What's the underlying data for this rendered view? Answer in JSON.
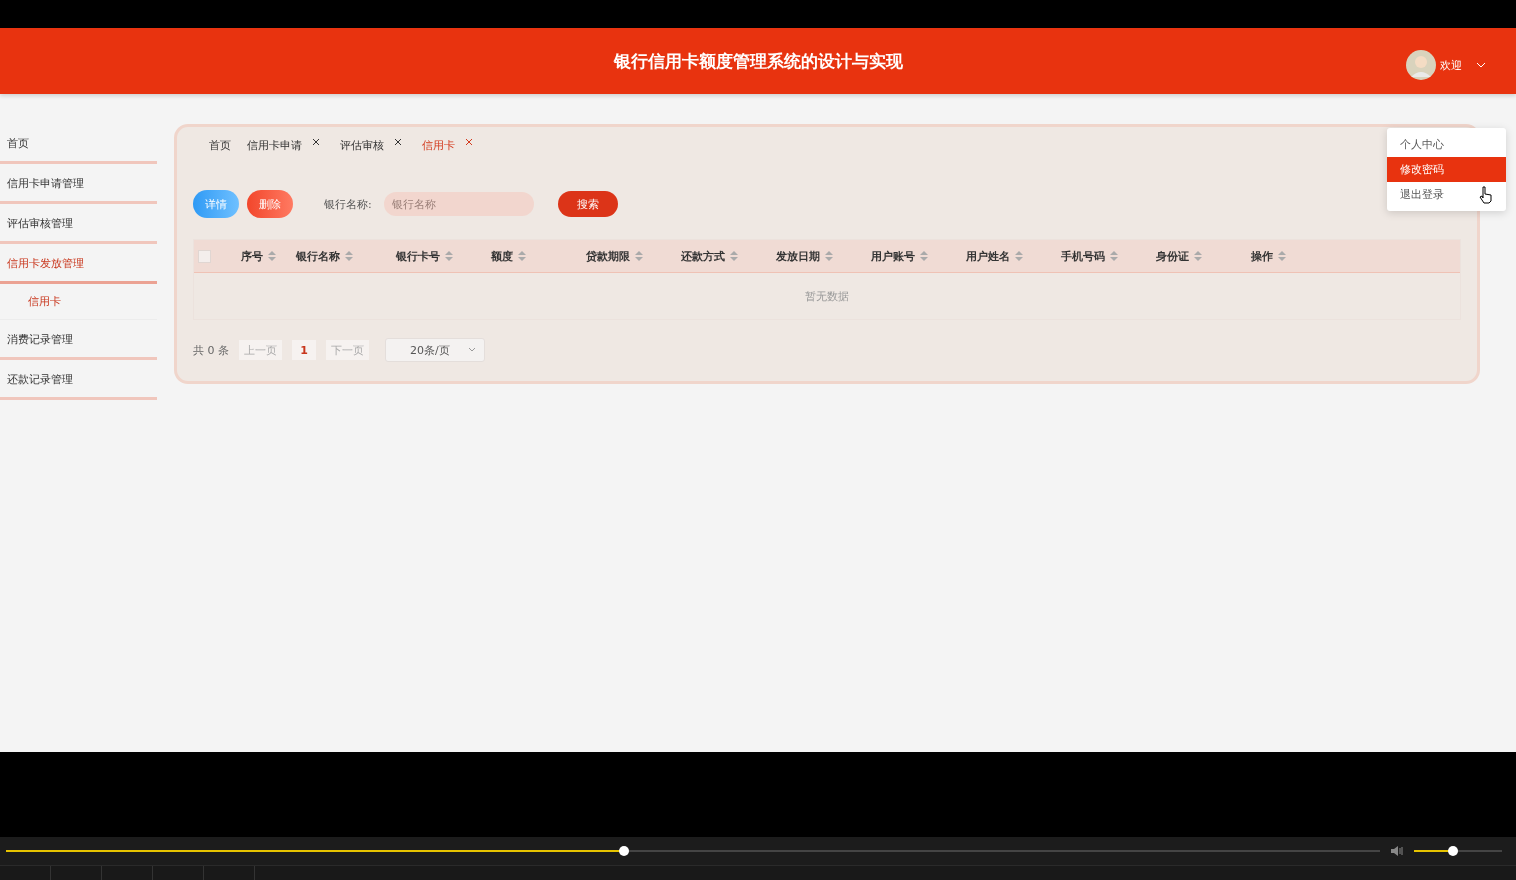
{
  "header": {
    "title": "银行信用卡额度管理系统的设计与实现",
    "greeting": "欢迎"
  },
  "user_menu": [
    {
      "label": "个人中心",
      "selected": false
    },
    {
      "label": "修改密码",
      "selected": true
    },
    {
      "label": "退出登录",
      "selected": false
    }
  ],
  "sidebar": {
    "items": [
      {
        "label": "首页",
        "selected": false
      },
      {
        "label": "信用卡申请管理",
        "selected": false
      },
      {
        "label": "评估审核管理",
        "selected": false
      },
      {
        "label": "信用卡发放管理",
        "selected": true,
        "children": [
          {
            "label": "信用卡",
            "selected": true
          }
        ]
      },
      {
        "label": "消费记录管理",
        "selected": false
      },
      {
        "label": "还款记录管理",
        "selected": false
      }
    ]
  },
  "tabs": [
    {
      "label": "首页",
      "selected": false,
      "closable": false
    },
    {
      "label": "信用卡申请",
      "selected": false,
      "closable": true
    },
    {
      "label": "评估审核",
      "selected": false,
      "closable": true
    },
    {
      "label": "信用卡",
      "selected": true,
      "closable": true
    }
  ],
  "toolbar": {
    "buttons": [
      {
        "label": "详情",
        "kind": "detail"
      },
      {
        "label": "删除",
        "kind": "delete"
      }
    ],
    "search": {
      "label": "银行名称:",
      "placeholder": "银行名称"
    },
    "search_button": "搜索"
  },
  "table": {
    "select_all": {
      "checked": false
    },
    "columns": [
      "序号",
      "银行名称",
      "银行卡号",
      "额度",
      "贷款期限",
      "还款方式",
      "发放日期",
      "用户账号",
      "用户姓名",
      "手机号码",
      "身份证",
      "操作"
    ],
    "empty_text": "暂无数据"
  },
  "pagination": {
    "total": "共 0 条",
    "prev": "上一页",
    "pages": [
      {
        "label": "1",
        "selected": true
      }
    ],
    "next": "下一页",
    "page_size": "20条/页"
  },
  "player": {
    "progress": {
      "level": 0.45
    },
    "volume": {
      "level": 0.44
    }
  }
}
